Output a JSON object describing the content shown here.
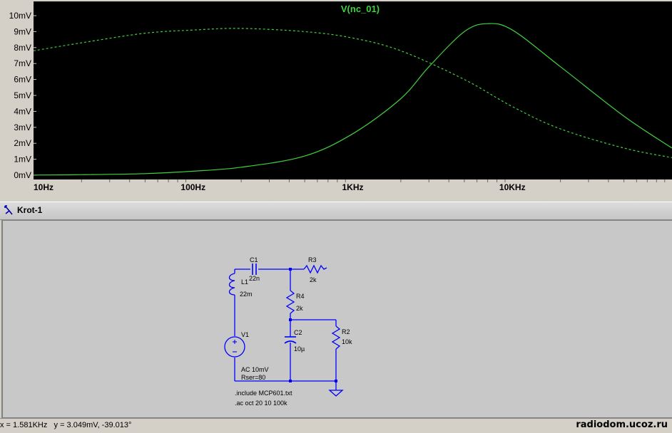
{
  "plot": {
    "title": "V(nc_01)",
    "y_ticks": [
      "0mV",
      "1mV",
      "2mV",
      "3mV",
      "4mV",
      "5mV",
      "6mV",
      "7mV",
      "8mV",
      "9mV",
      "10mV"
    ],
    "x_ticks": [
      "10Hz",
      "100Hz",
      "1KHz",
      "10KHz"
    ],
    "colors": {
      "background": "#000000",
      "trace": "#3fd13f",
      "title": "#3fd13f",
      "axis_text": "#000000"
    }
  },
  "chart_data": {
    "type": "line",
    "title": "V(nc_01)",
    "xlabel": "",
    "ylabel": "",
    "x_scale": "log",
    "xlim": [
      10,
      100000
    ],
    "ylim": [
      0,
      10
    ],
    "y_unit": "mV",
    "grid": false,
    "series": [
      {
        "style": "solid",
        "x": [
          10,
          20,
          50,
          100,
          200,
          500,
          1000,
          2000,
          3000,
          5000,
          7000,
          10000,
          20000,
          50000,
          100000
        ],
        "y": [
          0.01,
          0.03,
          0.1,
          0.25,
          0.5,
          1.2,
          2.6,
          4.8,
          6.8,
          9.0,
          9.5,
          9.1,
          6.8,
          3.7,
          1.7
        ]
      },
      {
        "style": "dashed",
        "x": [
          10,
          20,
          50,
          100,
          200,
          500,
          1000,
          2000,
          5000,
          10000,
          20000,
          50000,
          100000
        ],
        "y": [
          7.8,
          8.3,
          8.9,
          9.1,
          9.2,
          9.0,
          8.6,
          7.8,
          6.0,
          4.3,
          2.9,
          1.7,
          1.1
        ]
      }
    ]
  },
  "schematic_tab": {
    "title": "Krot-1",
    "icon": "schematic-icon"
  },
  "schematic": {
    "components": {
      "C1": {
        "name": "C1",
        "value": "22n"
      },
      "R3": {
        "name": "R3",
        "value": "2k"
      },
      "L1": {
        "name": "L1",
        "value": "22m"
      },
      "R4": {
        "name": "R4",
        "value": "2k"
      },
      "V1": {
        "name": "V1",
        "value": "AC 10mV",
        "extra": "Rser=80"
      },
      "C2": {
        "name": "C2",
        "value": "10µ"
      },
      "R2": {
        "name": "R2",
        "value": "10k"
      }
    },
    "directives": [
      ".include MCP601.txt",
      ".ac oct 20 10 100k"
    ],
    "wire_color": "#0000ff"
  },
  "status": {
    "text": "x = 1.581KHz   y = 3.049mV, -39.013°"
  },
  "watermark": "radiodom.ucoz.ru"
}
